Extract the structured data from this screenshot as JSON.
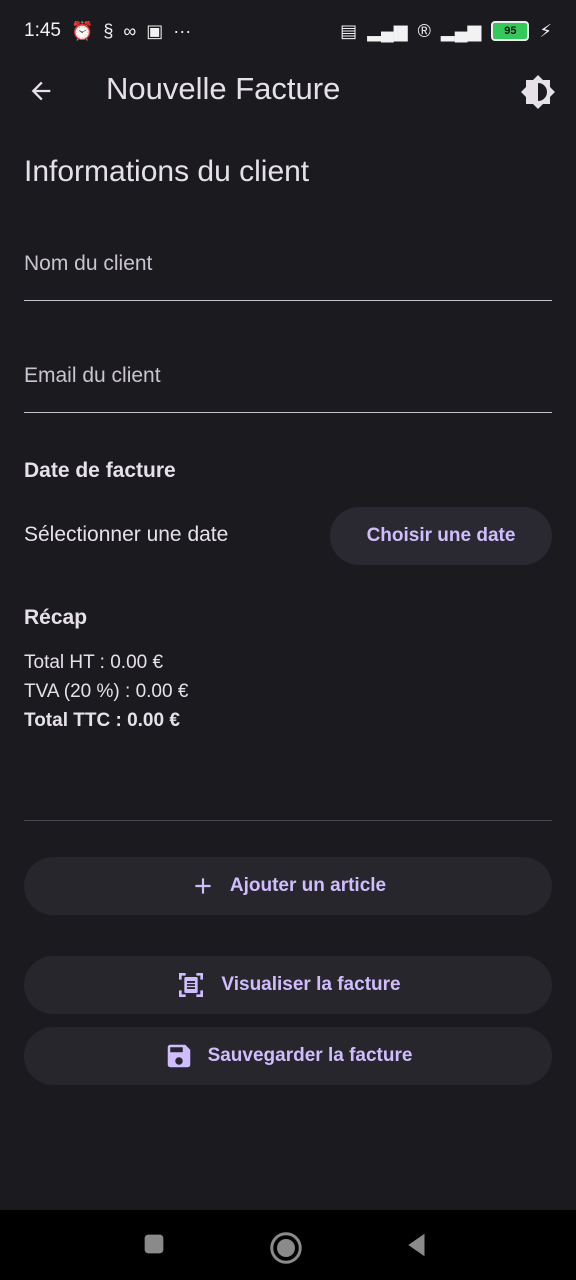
{
  "status_bar": {
    "time": "1:45",
    "battery": "95"
  },
  "app_bar": {
    "title": "Nouvelle Facture"
  },
  "client_section": {
    "title": "Informations du client",
    "name_placeholder": "Nom du client",
    "email_placeholder": "Email du client"
  },
  "date_section": {
    "title": "Date de facture",
    "selected_text": "Sélectionner une date",
    "choose_button": "Choisir une date"
  },
  "recap": {
    "title": "Récap",
    "total_ht": "Total HT : 0.00 €",
    "tva": "TVA (20 %) : 0.00 €",
    "total_ttc": "Total TTC : 0.00 €"
  },
  "actions": {
    "add_article": "Ajouter un article",
    "preview": "Visualiser la facture",
    "save": "Sauvegarder la facture"
  },
  "colors": {
    "background": "#1b1b1f",
    "accent": "#cfbdfe",
    "button_bg": "#27262c"
  }
}
